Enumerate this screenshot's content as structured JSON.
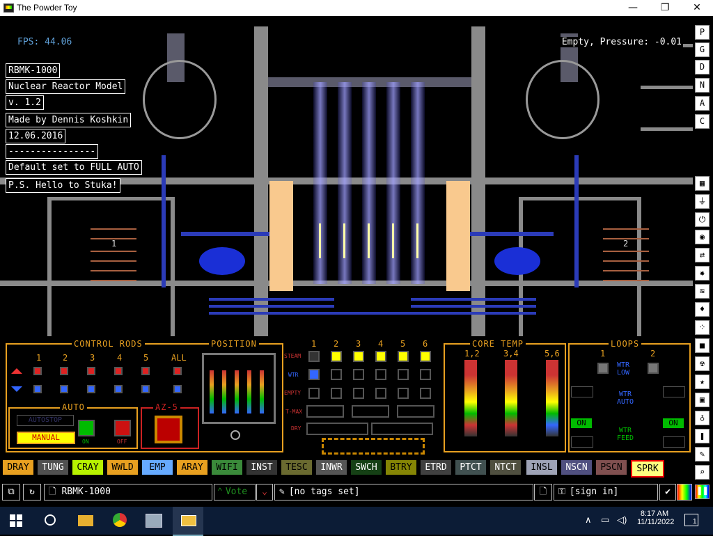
{
  "window": {
    "title": "The Powder Toy",
    "minimize": "—",
    "maximize": "❐",
    "close": "✕"
  },
  "sim": {
    "fps_label": "FPS:",
    "fps_value": "44.06",
    "pressure": "Empty, Pressure: -0.01",
    "notes": [
      "RBMK-1000",
      "Nuclear Reactor Model",
      "v. 1.2",
      "Made by Dennis Koshkin",
      "12.06.2016",
      "----------------",
      "Default set to FULL AUTO",
      "P.S. Hello to Stuka!"
    ],
    "loop_left": "1",
    "loop_right": "2"
  },
  "panel": {
    "control_rods": {
      "title": "CONTROL RODS",
      "columns": [
        "1",
        "2",
        "3",
        "4",
        "5",
        "ALL"
      ]
    },
    "auto": {
      "title": "AUTO",
      "autostop": "AUTOSTOP",
      "manual": "MANUAL",
      "on": "ON",
      "off": "OFF"
    },
    "az5": {
      "title": "AZ-5"
    },
    "position": {
      "title": "POSITION"
    },
    "status": {
      "columns": [
        "1",
        "2",
        "3",
        "4",
        "5",
        "6"
      ],
      "rows": [
        "STEAM",
        "WTR",
        "EMPTY",
        "T-MAX",
        "DRY"
      ]
    },
    "core_temp": {
      "title": "CORE  TEMP",
      "groups": [
        "1,2",
        "3,4",
        "5,6"
      ]
    },
    "loops": {
      "title": "LOOPS",
      "columns": [
        "1",
        "2"
      ],
      "wtr_low": "WTR\nLOW",
      "wtr_auto": "WTR\nAUTO",
      "wtr_feed": "WTR\nFEED",
      "on": "ON"
    }
  },
  "elements": [
    {
      "label": "DRAY",
      "bg": "#e8a020",
      "fg": "#000"
    },
    {
      "label": "TUNG",
      "bg": "#505050",
      "fg": "#fff"
    },
    {
      "label": "CRAY",
      "bg": "#b7f200",
      "fg": "#000"
    },
    {
      "label": "WWLD",
      "bg": "#e8a020",
      "fg": "#000"
    },
    {
      "label": "EMP",
      "bg": "#66aaff",
      "fg": "#000"
    },
    {
      "label": "ARAY",
      "bg": "#e8a020",
      "fg": "#000"
    },
    {
      "label": "WIFI",
      "bg": "#3a8a3a",
      "fg": "#000"
    },
    {
      "label": "INST",
      "bg": "#333333",
      "fg": "#fff"
    },
    {
      "label": "TESC",
      "bg": "#6a6a30",
      "fg": "#000"
    },
    {
      "label": "INWR",
      "bg": "#555555",
      "fg": "#fff"
    },
    {
      "label": "SWCH",
      "bg": "#154015",
      "fg": "#fff"
    },
    {
      "label": "BTRY",
      "bg": "#858505",
      "fg": "#000"
    },
    {
      "label": "ETRD",
      "bg": "#404040",
      "fg": "#fff"
    },
    {
      "label": "PTCT",
      "bg": "#405050",
      "fg": "#fff"
    },
    {
      "label": "NTCT",
      "bg": "#505040",
      "fg": "#fff"
    },
    {
      "label": "INSL",
      "bg": "#9ea3b6",
      "fg": "#000"
    },
    {
      "label": "NSCN",
      "bg": "#505080",
      "fg": "#fff"
    },
    {
      "label": "PSCN",
      "bg": "#805050",
      "fg": "#000"
    },
    {
      "label": "SPRK",
      "bg": "#ffff80",
      "fg": "#000"
    }
  ],
  "sidebar": {
    "top": [
      "P",
      "G",
      "D",
      "N",
      "A",
      "C"
    ]
  },
  "bottombar": {
    "save_name": "RBMK-1000",
    "vote": "Vote",
    "tags": "[no tags set]",
    "sign_in": "[sign in]"
  },
  "taskbar": {
    "time": "8:17 AM",
    "date": "11/11/2022",
    "notification_count": "1"
  }
}
